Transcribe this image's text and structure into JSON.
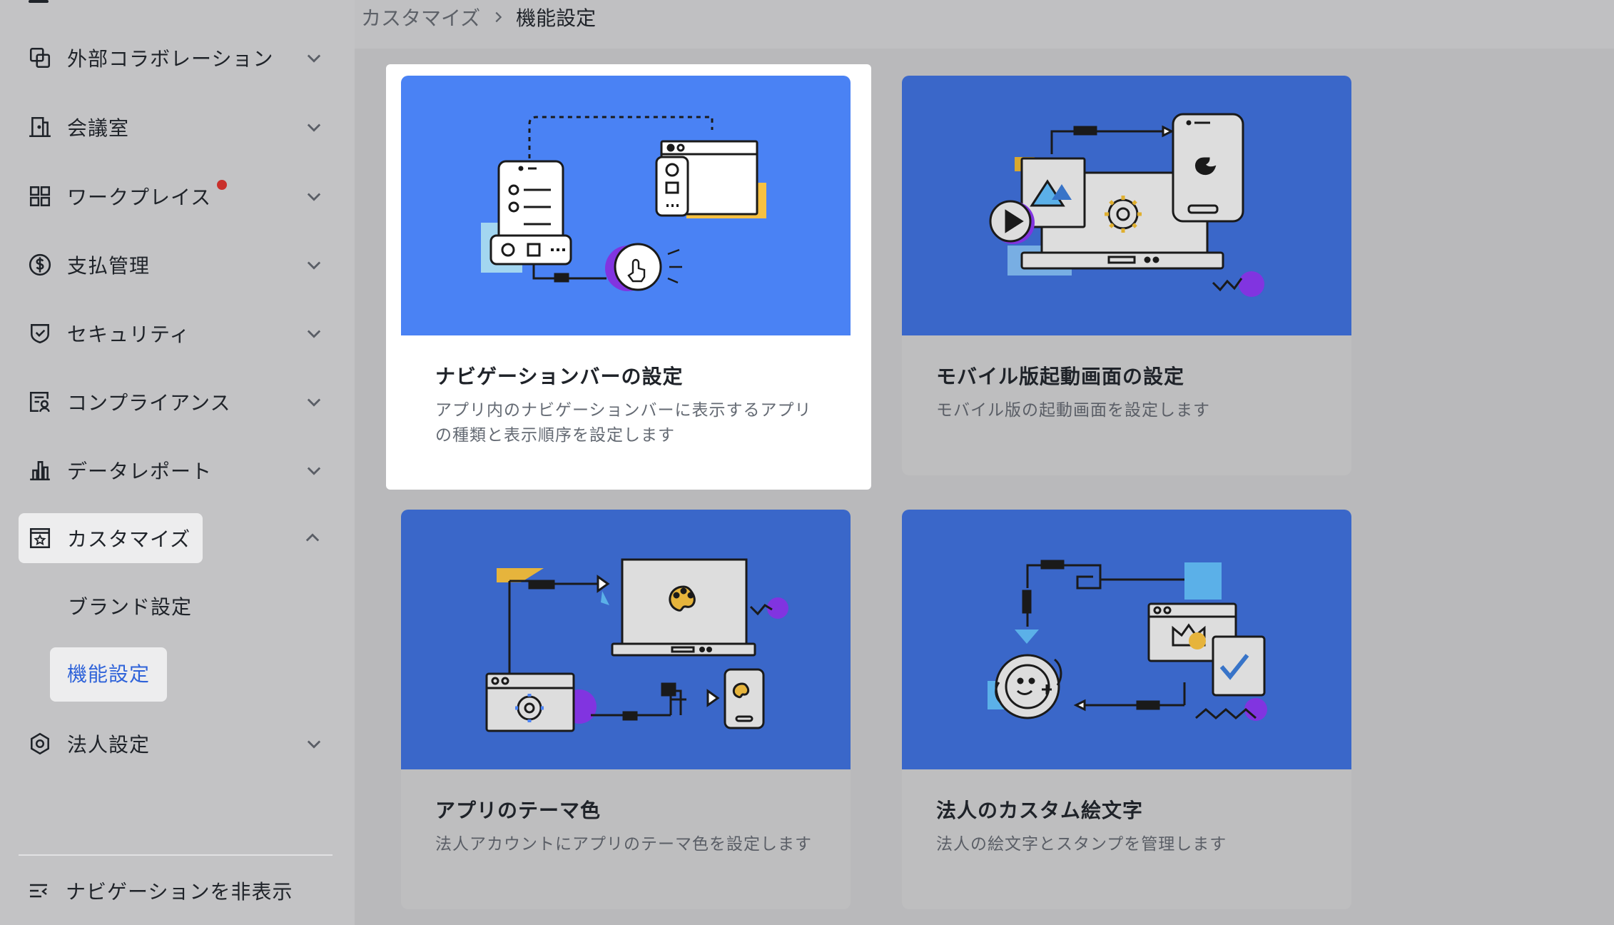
{
  "sidebar": {
    "items": [
      {
        "label": "外部コラボレーション",
        "icon": "collaboration-icon",
        "expanded": false
      },
      {
        "label": "会議室",
        "icon": "meeting-room-icon",
        "expanded": false
      },
      {
        "label": "ワークプレイス",
        "icon": "workplace-grid-icon",
        "expanded": false,
        "badge_color": "#c9302c"
      },
      {
        "label": "支払管理",
        "icon": "payment-icon",
        "expanded": false
      },
      {
        "label": "セキュリティ",
        "icon": "shield-check-icon",
        "expanded": false
      },
      {
        "label": "コンプライアンス",
        "icon": "compliance-icon",
        "expanded": false
      },
      {
        "label": "データレポート",
        "icon": "bar-chart-icon",
        "expanded": false
      },
      {
        "label": "カスタマイズ",
        "icon": "customize-star-icon",
        "expanded": true
      },
      {
        "label": "法人設定",
        "icon": "org-settings-icon",
        "expanded": false
      }
    ],
    "subitems": [
      {
        "label": "ブランド設定",
        "active": false
      },
      {
        "label": "機能設定",
        "active": true
      }
    ],
    "hide_navigation_label": "ナビゲーションを非表示"
  },
  "breadcrumb": {
    "parent": "カスタマイズ",
    "current": "機能設定"
  },
  "cards": [
    {
      "title": "ナビゲーションバーの設定",
      "description": "アプリ内のナビゲーションバーに表示するアプリの種類と表示順序を設定します",
      "highlighted": true
    },
    {
      "title": "モバイル版起動画面の設定",
      "description": "モバイル版の起動画面を設定します",
      "highlighted": false
    },
    {
      "title": "アプリのテーマ色",
      "description": "法人アカウントにアプリのテーマ色を設定します",
      "highlighted": false
    },
    {
      "title": "法人のカスタム絵文字",
      "description": "法人の絵文字とスタンプを管理します",
      "highlighted": false
    }
  ],
  "colors": {
    "accent": "#2f63d9",
    "card_illustration": "#3a67c9",
    "card_illustration_active": "#4a82f4",
    "badge": "#c9302c"
  }
}
